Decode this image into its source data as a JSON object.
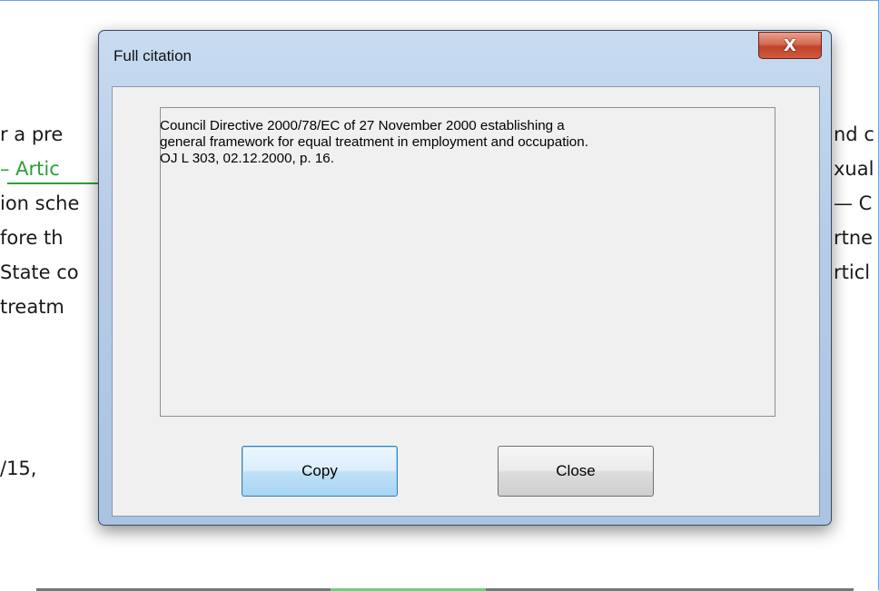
{
  "background_document": {
    "lines": [
      {
        "text": "r a pre",
        "color": "dark"
      },
      {
        "text": "– Artic",
        "color": "green"
      },
      {
        "text": "ion sche",
        "color": "dark"
      },
      {
        "text": "fore th",
        "color": "dark"
      },
      {
        "text": "State co",
        "color": "dark"
      },
      {
        "text": " treatm",
        "color": "dark"
      },
      {
        "text": "/15,",
        "color": "dark"
      }
    ],
    "right_fragments": [
      {
        "text": "nd c",
        "color": "dark"
      },
      {
        "text": "xual",
        "color": "dark"
      },
      {
        "text": "— C",
        "color": "dark"
      },
      {
        "text": "rtne",
        "color": "dark"
      },
      {
        "text": "rticl",
        "color": "dark"
      }
    ]
  },
  "dialog": {
    "title": "Full citation",
    "close_icon_glyph": "X",
    "citation_lines": [
      "Council Directive 2000/78/EC of 27 November 2000 establishing a",
      "general framework for equal treatment in employment and occupation.",
      "OJ L 303, 02.12.2000, p. 16."
    ],
    "buttons": {
      "copy": "Copy",
      "close": "Close"
    }
  },
  "colors": {
    "link_green": "#2e9e3a",
    "close_red": "#c0422a",
    "frame_blue": "#b6cde8"
  }
}
